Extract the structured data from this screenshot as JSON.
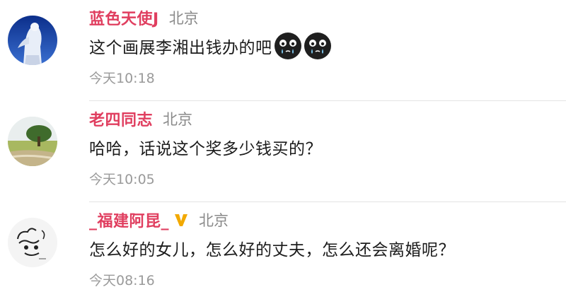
{
  "comments": [
    {
      "username": "蓝色天使J",
      "location": "北京",
      "text": "这个画展李湘出钱办的吧",
      "emojis": [
        "crying-face-icon",
        "crying-face-icon"
      ],
      "time": "今天10:18",
      "avatar": "angel-statue-avatar"
    },
    {
      "username": "老四同志",
      "location": "北京",
      "text": "哈哈，话说这个奖多少钱买的？",
      "time": "今天10:05",
      "avatar": "tree-landscape-avatar"
    },
    {
      "username": "_福建阿昆_",
      "badge": "verified-v-icon",
      "location": "北京",
      "text": "怎么好的女儿，怎么好的丈夫，怎么还会离婚呢？",
      "time": "今天08:16",
      "avatar": "sketch-drawing-avatar"
    }
  ],
  "colors": {
    "username": "#e03e5f",
    "location": "#8a8a8a",
    "time": "#9a9a9a",
    "badge": "#f2a900"
  }
}
